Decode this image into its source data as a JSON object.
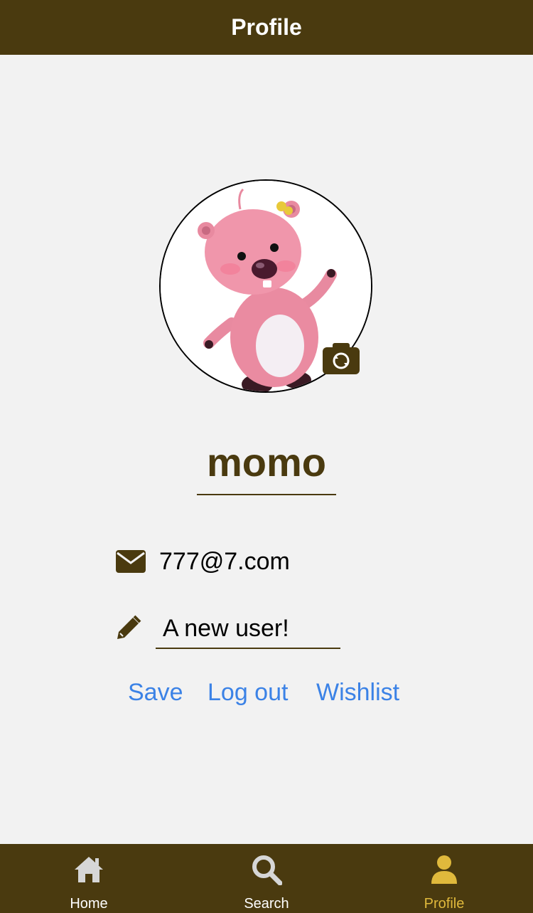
{
  "header": {
    "title": "Profile"
  },
  "profile": {
    "username": "momo",
    "email": "777@7.com",
    "bio": "A new user!"
  },
  "actions": {
    "save": "Save",
    "logout": "Log out",
    "wishlist": "Wishlist"
  },
  "tabs": [
    {
      "label": "Home",
      "icon": "home-icon",
      "active": false
    },
    {
      "label": "Search",
      "icon": "search-icon",
      "active": false
    },
    {
      "label": "Profile",
      "icon": "user-icon",
      "active": true
    }
  ],
  "colors": {
    "brand": "#4a3a0f",
    "link": "#3b82e6",
    "tab_inactive": "#d6d6d6",
    "tab_active": "#e0b93c",
    "background": "#f2f2f2"
  }
}
